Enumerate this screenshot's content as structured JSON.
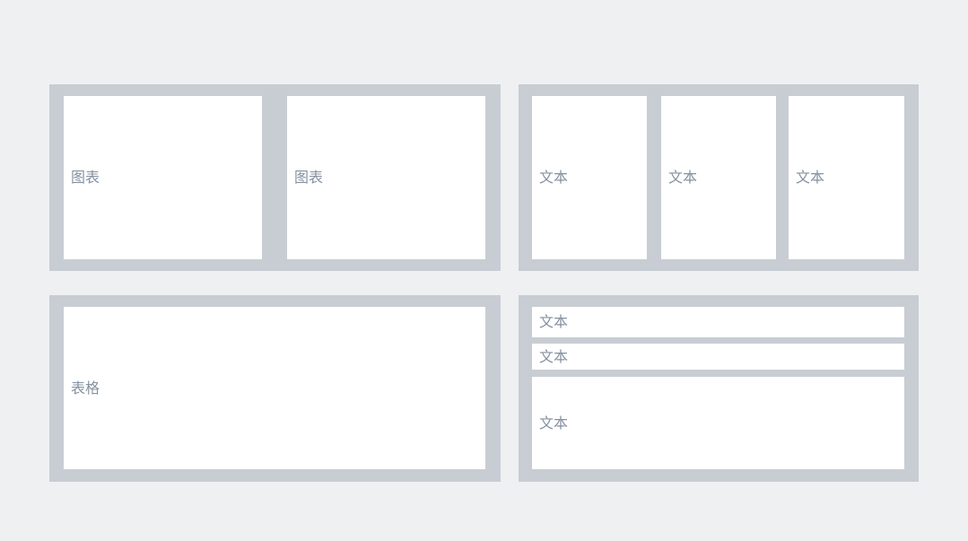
{
  "layout_preview": {
    "top_left_group": {
      "slots": [
        {
          "label": "图表"
        },
        {
          "label": "图表"
        }
      ]
    },
    "top_right_group": {
      "slots": [
        {
          "label": "文本"
        },
        {
          "label": "文本"
        },
        {
          "label": "文本"
        }
      ]
    },
    "bottom_left_group": {
      "slots": [
        {
          "label": "表格"
        }
      ]
    },
    "bottom_right_group": {
      "slots": [
        {
          "label": "文本"
        },
        {
          "label": "文本"
        },
        {
          "label": "文本"
        }
      ]
    }
  },
  "colors": {
    "page_background": "#eff0f2",
    "group_background": "#c8cdd3",
    "slot_background": "#ffffff",
    "label_text": "#8591a0"
  }
}
